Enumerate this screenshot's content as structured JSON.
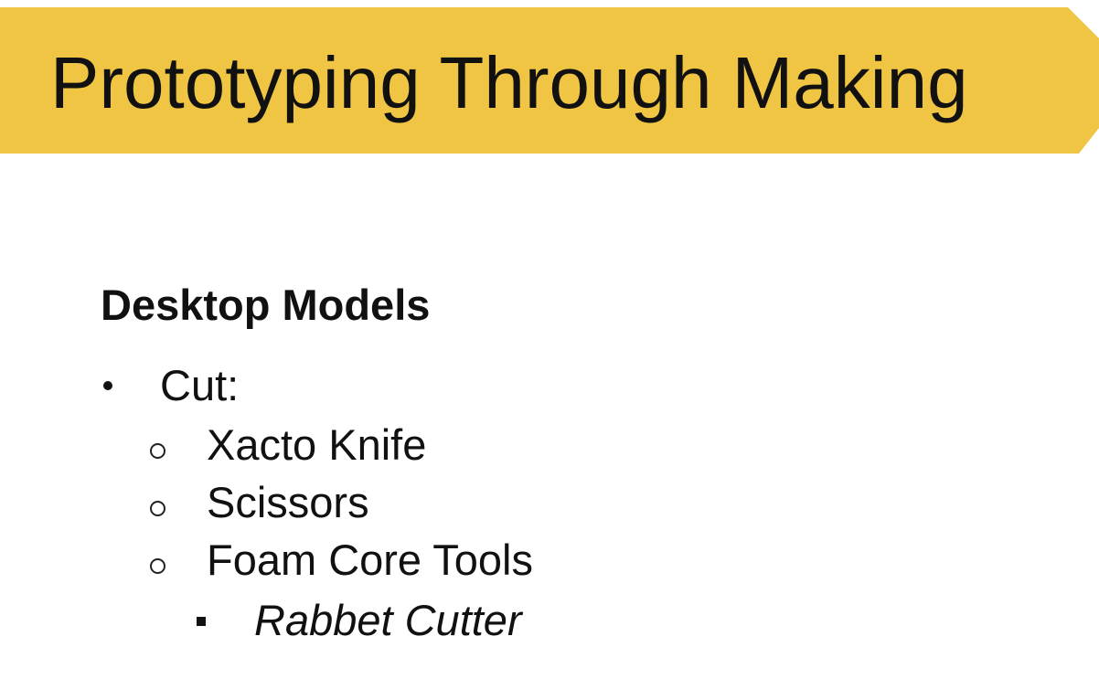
{
  "slide": {
    "title": "Prototyping Through Making",
    "heading": "Desktop Models",
    "bullets": {
      "level1": {
        "label": "Cut:",
        "marker": "bullet-disc-icon"
      },
      "level2": [
        {
          "label": "Xacto Knife",
          "marker": "bullet-circle-icon"
        },
        {
          "label": "Scissors",
          "marker": "bullet-circle-icon"
        },
        {
          "label": "Foam Core Tools",
          "marker": "bullet-circle-icon"
        }
      ],
      "level3": [
        {
          "label": "Rabbet Cutter",
          "marker": "bullet-square-icon"
        }
      ]
    }
  },
  "colors": {
    "banner": "#f0c544",
    "text": "#111111",
    "background": "#ffffff"
  }
}
